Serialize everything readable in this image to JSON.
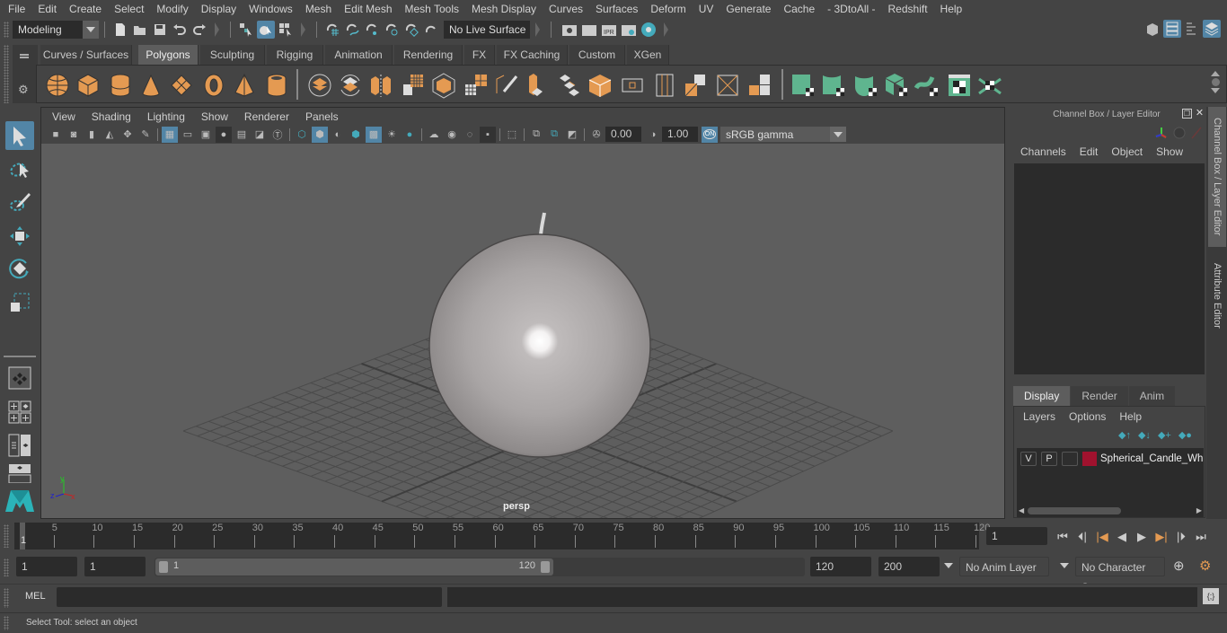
{
  "menubar": {
    "items": [
      "File",
      "Edit",
      "Create",
      "Select",
      "Modify",
      "Display",
      "Windows",
      "Mesh",
      "Edit Mesh",
      "Mesh Tools",
      "Mesh Display",
      "Curves",
      "Surfaces",
      "Deform",
      "UV",
      "Generate",
      "Cache",
      "- 3DtoAll -",
      "Redshift",
      "Help"
    ]
  },
  "statusline": {
    "mode": "Modeling",
    "live_surface": "No Live Surface"
  },
  "shelf": {
    "tabs": [
      "Curves / Surfaces",
      "Polygons",
      "Sculpting",
      "Rigging",
      "Animation",
      "Rendering",
      "FX",
      "FX Caching",
      "Custom",
      "XGen"
    ],
    "active_tab": "Polygons"
  },
  "viewport": {
    "menu": [
      "View",
      "Shading",
      "Lighting",
      "Show",
      "Renderer",
      "Panels"
    ],
    "exposure": "0.00",
    "gamma": "1.00",
    "color_space": "sRGB gamma",
    "color_mgmt_label": "ON",
    "camera_label": "persp",
    "axis": {
      "x": "x",
      "y": "y",
      "z": "z"
    }
  },
  "channel_box": {
    "title": "Channel Box / Layer Editor",
    "menu": [
      "Channels",
      "Edit",
      "Object",
      "Show"
    ]
  },
  "layer_editor": {
    "tabs": [
      "Display",
      "Render",
      "Anim"
    ],
    "active_tab": "Display",
    "menu": [
      "Layers",
      "Options",
      "Help"
    ],
    "layers": [
      {
        "v": "V",
        "p": "P",
        "color": "#a0122e",
        "name": "Spherical_Candle_White"
      }
    ]
  },
  "side_tabs": [
    "Channel Box / Layer Editor",
    "Attribute Editor"
  ],
  "timeline": {
    "ticks": [
      5,
      10,
      15,
      20,
      25,
      30,
      35,
      40,
      45,
      50,
      55,
      60,
      65,
      70,
      75,
      80,
      85,
      90,
      95,
      100,
      105,
      110,
      115,
      120
    ],
    "current_frame_marker": "1",
    "current_frame": "1",
    "max": 120
  },
  "range": {
    "start": "1",
    "anim_start": "1",
    "slider_min": "1",
    "slider_max": "120",
    "end": "120",
    "anim_end": "200",
    "anim_layer": "No Anim Layer",
    "character_set": "No Character Set"
  },
  "command": {
    "label": "MEL"
  },
  "help_line": {
    "text": "Select Tool: select an object"
  }
}
